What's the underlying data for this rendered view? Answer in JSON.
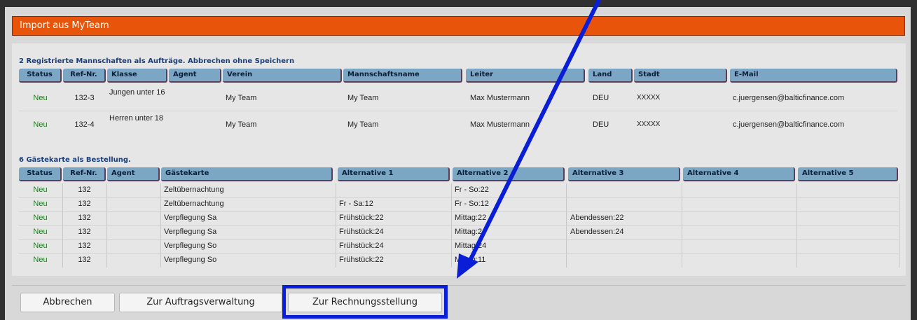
{
  "dialog": {
    "title": "Import aus MyTeam"
  },
  "section1": {
    "title": "2 Registrierte Mannschaften als Aufträge. Abbrechen ohne Speichern",
    "headers": [
      "Status",
      "Ref-Nr.",
      "Klasse",
      "Agent",
      "Verein",
      "Mannschaftsname",
      "Leiter",
      "Land",
      "Stadt",
      "E-Mail"
    ],
    "rows": [
      {
        "status": "Neu",
        "ref": "132-3",
        "klasse": "Jungen unter 16",
        "agent": "",
        "verein": "My Team",
        "mannschaft": "My Team",
        "leiter": "Max Mustermann",
        "land": "DEU",
        "stadt": "XXXXX",
        "email": "c.juergensen@balticfinance.com"
      },
      {
        "status": "Neu",
        "ref": "132-4",
        "klasse": "Herren unter 18",
        "agent": "",
        "verein": "My Team",
        "mannschaft": "My Team",
        "leiter": "Max Mustermann",
        "land": "DEU",
        "stadt": "XXXXX",
        "email": "c.juergensen@balticfinance.com"
      }
    ]
  },
  "section2": {
    "title": "6 Gästekarte als Bestellung.",
    "headers": [
      "Status",
      "Ref-Nr.",
      "Agent",
      "Gästekarte",
      "Alternative 1",
      "Alternative 2",
      "Alternative 3",
      "Alternative 4",
      "Alternative 5"
    ],
    "rows": [
      {
        "status": "Neu",
        "ref": "132",
        "agent": "",
        "karte": "Zeltübernachtung",
        "alt1": "",
        "alt2": "Fr - So:22",
        "alt3": "",
        "alt4": "",
        "alt5": ""
      },
      {
        "status": "Neu",
        "ref": "132",
        "agent": "",
        "karte": "Zeltübernachtung",
        "alt1": "Fr - Sa:12",
        "alt2": "Fr - So:12",
        "alt3": "",
        "alt4": "",
        "alt5": ""
      },
      {
        "status": "Neu",
        "ref": "132",
        "agent": "",
        "karte": "Verpflegung Sa",
        "alt1": "Frühstück:22",
        "alt2": "Mittag:22",
        "alt3": "Abendessen:22",
        "alt4": "",
        "alt5": ""
      },
      {
        "status": "Neu",
        "ref": "132",
        "agent": "",
        "karte": "Verpflegung Sa",
        "alt1": "Frühstück:24",
        "alt2": "Mittag:24",
        "alt3": "Abendessen:24",
        "alt4": "",
        "alt5": ""
      },
      {
        "status": "Neu",
        "ref": "132",
        "agent": "",
        "karte": "Verpflegung So",
        "alt1": "Frühstück:24",
        "alt2": "Mittag:24",
        "alt3": "",
        "alt4": "",
        "alt5": ""
      },
      {
        "status": "Neu",
        "ref": "132",
        "agent": "",
        "karte": "Verpflegung So",
        "alt1": "Frühstück:22",
        "alt2": "Mittag:11",
        "alt3": "",
        "alt4": "",
        "alt5": ""
      }
    ]
  },
  "buttons": {
    "cancel": "Abbrechen",
    "orders": "Zur Auftragsverwaltung",
    "billing": "Zur Rechnungsstellung"
  },
  "annotation": {
    "color": "#0a1ed8",
    "arrow_icon": "arrow-icon"
  },
  "colors": {
    "titlebar": "#e8550a",
    "header": "#7ba6c4",
    "status_new": "#1f7a1f"
  }
}
